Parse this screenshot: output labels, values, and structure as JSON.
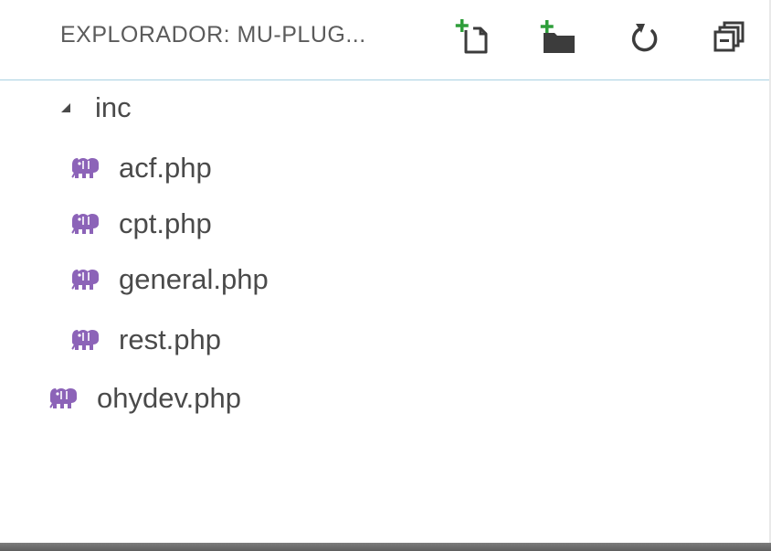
{
  "header": {
    "title": "EXPLORADOR: MU-PLUG...",
    "actions": [
      {
        "icon": "new-file-icon"
      },
      {
        "icon": "new-folder-icon"
      },
      {
        "icon": "refresh-icon"
      },
      {
        "icon": "collapse-all-icon"
      }
    ]
  },
  "tree": {
    "folder": {
      "label": "inc",
      "expanded": true,
      "icon": "expanded-triangle-icon"
    },
    "children": [
      {
        "label": "acf.php",
        "icon": "php-elephant-icon"
      },
      {
        "label": "cpt.php",
        "icon": "php-elephant-icon"
      },
      {
        "label": "general.php",
        "icon": "php-elephant-icon"
      },
      {
        "label": "rest.php",
        "icon": "php-elephant-icon"
      }
    ],
    "root_files": [
      {
        "label": "ohydev.php",
        "icon": "php-elephant-icon"
      }
    ]
  },
  "colors": {
    "php_icon": "#8c63b8",
    "add_plus": "#2e9e3a",
    "header_divider": "#a9d1e2",
    "text": "#4a4a4a"
  }
}
